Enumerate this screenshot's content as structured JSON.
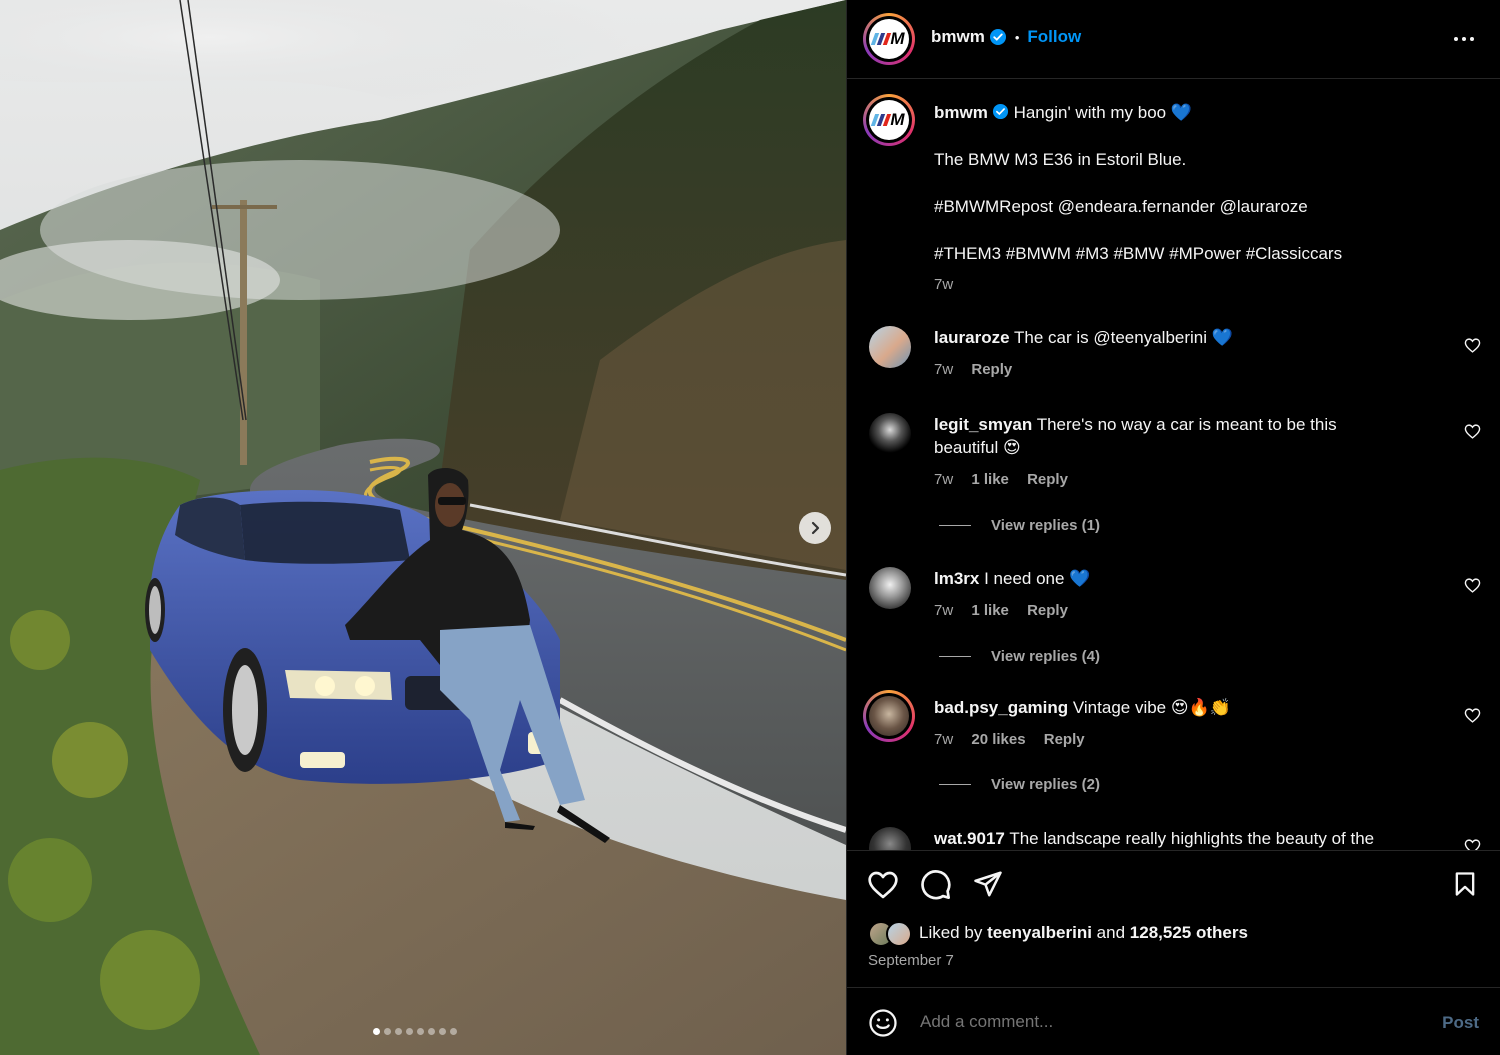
{
  "post": {
    "author": "bmwm",
    "follow_label": "Follow",
    "separator": "•",
    "caption": {
      "line1": "Hangin' with my boo 💙",
      "line2": "The BMW M3 E36 in Estoril Blue.",
      "line3": "#BMWMRepost @endeara.fernander @lauraroze",
      "line4": "#THEM3 #BMWM #M3 #BMW #MPower #Classiccars",
      "age": "7w"
    },
    "carousel": {
      "total_slides": 8,
      "active_slide": 1
    }
  },
  "comments": [
    {
      "user": "lauraroze",
      "text": "The car is @teenyalberini 💙",
      "age": "7w",
      "likes": "",
      "reply": "Reply",
      "view_replies": ""
    },
    {
      "user": "legit_smyan",
      "text": "There's no way a car is meant to be this",
      "text2": "beautiful 😍",
      "age": "7w",
      "likes": "1 like",
      "reply": "Reply",
      "view_replies": "View replies (1)"
    },
    {
      "user": "lm3rx",
      "text": "I need one 💙",
      "age": "7w",
      "likes": "1 like",
      "reply": "Reply",
      "view_replies": "View replies (4)"
    },
    {
      "user": "bad.psy_gaming",
      "text": "Vintage vibe 😍🔥👏",
      "age": "7w",
      "likes": "20 likes",
      "reply": "Reply",
      "view_replies": "View replies (2)"
    },
    {
      "user": "wat.9017",
      "text": "The landscape really highlights the beauty of the",
      "age": "",
      "likes": "",
      "reply": "",
      "view_replies": ""
    }
  ],
  "engagement": {
    "liked_by_prefix": "Liked by",
    "liked_by_user": "teenyalberini",
    "liked_by_and": "and",
    "others": "128,525 others",
    "date": "September 7"
  },
  "composer": {
    "placeholder": "Add a comment...",
    "post_label": "Post"
  },
  "icons": {
    "verified": "verified-badge-icon",
    "more": "more-options-icon",
    "like": "heart-icon",
    "comment": "comment-bubble-icon",
    "share": "paper-plane-icon",
    "save": "bookmark-icon",
    "emoji": "emoji-smile-icon",
    "next": "chevron-right-icon"
  },
  "colors": {
    "accent": "#0095f6",
    "muted": "#a8a8a8",
    "background": "#000000",
    "car_blue": "#3b55a8"
  }
}
